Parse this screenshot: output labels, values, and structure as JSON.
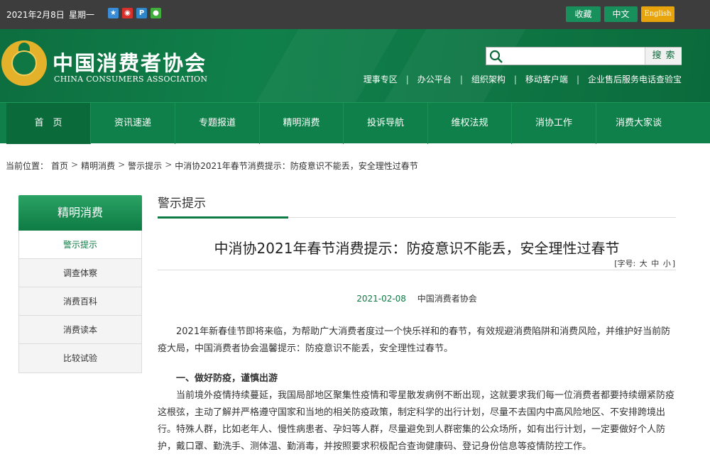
{
  "topbar": {
    "date": "2021年2月8日",
    "weekday": "星期一",
    "favorite": "收藏",
    "chinese": "中文",
    "english": "English"
  },
  "header": {
    "logo_cn": "中国消费者协会",
    "logo_en": "CHINA CONSUMERS ASSOCIATION",
    "search_placeholder": "",
    "search_button": "搜索",
    "quicklinks": [
      "理事专区",
      "办公平台",
      "组织架构",
      "移动客户端",
      "企业售后服务电话查验宝"
    ]
  },
  "nav": {
    "items": [
      "首　页",
      "资讯速递",
      "专题报道",
      "精明消费",
      "投诉导航",
      "维权法规",
      "消协工作",
      "消费大家谈"
    ]
  },
  "breadcrumb": {
    "label": "当前位置：",
    "items": [
      "首页",
      "精明消费",
      "警示提示",
      "中消协2021年春节消费提示：防疫意识不能丢，安全理性过春节"
    ]
  },
  "sidebar": {
    "title": "精明消费",
    "items": [
      "警示提示",
      "调查体察",
      "消费百科",
      "消费读本",
      "比较试验"
    ]
  },
  "main": {
    "section_title": "警示提示",
    "article_title": "中消协2021年春节消费提示：防疫意识不能丢，安全理性过春节",
    "fontsize_label": "[字号:",
    "fontsize_large": "大",
    "fontsize_medium": "中",
    "fontsize_small": "小",
    "fontsize_close": "]",
    "date": "2021-02-08",
    "source": "中国消费者协会",
    "para1": "2021年新春佳节即将来临，为帮助广大消费者度过一个快乐祥和的春节，有效规避消费陷阱和消费风险，并维护好当前防疫大局，中国消费者协会温馨提示：防疫意识不能丢，安全理性过春节。",
    "heading1": "一、做好防疫，谨慎出游",
    "para2": "当前境外疫情持续蔓延，我国局部地区聚集性疫情和零星散发病例不断出现，这就要求我们每一位消费者都要持续绷紧防疫这根弦，主动了解并严格遵守国家和当地的相关防疫政策，制定科学的出行计划，尽量不去国内中高风险地区、不安排跨境出行。特殊人群，比如老年人、慢性病患者、孕妇等人群，尽量避免到人群密集的公众场所，如有出行计划，一定要做好个人防护，戴口罩、勤洗手、测体温、勤消毒，并按照要求积极配合查询健康码、登记身份信息等疫情防控工作。"
  }
}
